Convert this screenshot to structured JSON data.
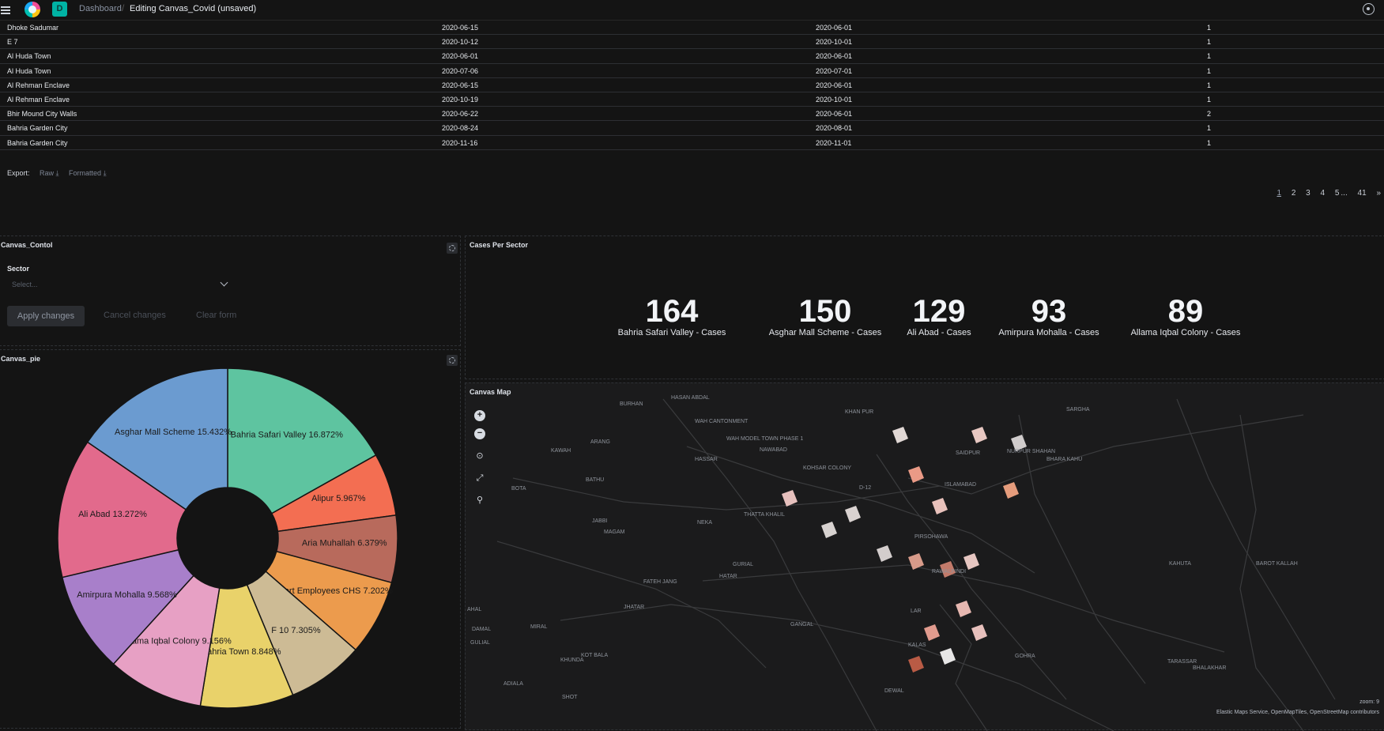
{
  "header": {
    "breadcrumb_dashboard": "Dashboard",
    "breadcrumb_current": "Editing Canvas_Covid (unsaved)",
    "space_initial": "D"
  },
  "table": {
    "rows": [
      [
        "Dhoke Sadumar",
        "2020-06-15",
        "2020-06-01",
        "1"
      ],
      [
        "E 7",
        "2020-10-12",
        "2020-10-01",
        "1"
      ],
      [
        "Al Huda Town",
        "2020-06-01",
        "2020-06-01",
        "1"
      ],
      [
        "Al Huda Town",
        "2020-07-06",
        "2020-07-01",
        "1"
      ],
      [
        "Al Rehman Enclave",
        "2020-06-15",
        "2020-06-01",
        "1"
      ],
      [
        "Al Rehman Enclave",
        "2020-10-19",
        "2020-10-01",
        "1"
      ],
      [
        "Bhir Mound City Walls",
        "2020-06-22",
        "2020-06-01",
        "2"
      ],
      [
        "Bahria Garden City",
        "2020-08-24",
        "2020-08-01",
        "1"
      ],
      [
        "Bahria Garden City",
        "2020-11-16",
        "2020-11-01",
        "1"
      ]
    ]
  },
  "export": {
    "label": "Export:",
    "raw": "Raw",
    "formatted": "Formatted"
  },
  "pagination": {
    "pages": [
      "1",
      "2",
      "3",
      "4",
      "5"
    ],
    "ellipsis": "...",
    "last": "41",
    "next": "»"
  },
  "control_panel": {
    "title": "Canvas_Contol",
    "sector_label": "Sector",
    "select_placeholder": "Select...",
    "apply": "Apply changes",
    "cancel": "Cancel changes",
    "clear": "Clear form"
  },
  "pie_panel": {
    "title": "Canvas_pie"
  },
  "metrics_panel": {
    "title": "Cases Per Sector",
    "items": [
      {
        "value": "164",
        "label": "Bahria Safari Valley - Cases"
      },
      {
        "value": "150",
        "label": "Asghar Mall Scheme - Cases"
      },
      {
        "value": "129",
        "label": "Ali Abad - Cases"
      },
      {
        "value": "93",
        "label": "Amirpura Mohalla - Cases"
      },
      {
        "value": "89",
        "label": "Allama Iqbal Colony - Cases"
      }
    ]
  },
  "map_panel": {
    "title": "Canvas Map",
    "zoom_label": "zoom: 9",
    "attribution": "Elastic Maps Service, OpenMapTiles, OpenStreetMap contributors",
    "place_labels": [
      "BURHAN",
      "HASAN ABDAL",
      "WAH CANTONMENT",
      "WAH MODEL TOWN PHASE 1",
      "KHAN PUR",
      "SARGHA",
      "NAWABAD",
      "KOHSAR COLONY",
      "SAIDPUR",
      "NURPUR SHAHAN",
      "BHARA KAHU",
      "KAWAH",
      "ARANG",
      "HASSAR",
      "D-12",
      "ISLAMABAD",
      "BATHU",
      "BOTA",
      "THATTA KHALIL",
      "JABBI",
      "MAGAM",
      "NEKA",
      "PIRSOHAWA",
      "BAROT KALLAH",
      "RAWALPINDI",
      "KAHUTA",
      "GURIAL",
      "HATAR",
      "FATEH JANG",
      "AHAL",
      "JHATAR",
      "GANGAL",
      "DAMAL",
      "MIRAL",
      "LAR",
      "KALAS",
      "GOHRA",
      "BHALAKHAR",
      "TARASSAR",
      "GULIAL",
      "KOT BALA",
      "KHUNDA",
      "ADIALA",
      "DEWAL",
      "SHOT"
    ]
  },
  "chart_data": {
    "type": "pie",
    "donut": true,
    "slices": [
      {
        "label": "Bahria Safari Valley",
        "percent": 16.872,
        "color": "#5ec4a0"
      },
      {
        "label": "Alipur",
        "percent": 5.967,
        "color": "#f36e52"
      },
      {
        "label": "Aria Muhallah",
        "percent": 6.379,
        "color": "#b86a5c"
      },
      {
        "label": "Airport Employees CHS",
        "percent": 7.202,
        "color": "#ec9b4d"
      },
      {
        "label": "F 10",
        "percent": 7.305,
        "color": "#cdbb95"
      },
      {
        "label": "Bahria Town",
        "percent": 8.848,
        "color": "#e9d26a"
      },
      {
        "label": "Allama Iqbal Colony",
        "percent": 9.156,
        "color": "#e7a0c4"
      },
      {
        "label": "Amirpura Mohalla",
        "percent": 9.568,
        "color": "#a87fca"
      },
      {
        "label": "Ali Abad",
        "percent": 13.272,
        "color": "#e26a8c"
      },
      {
        "label": "Asghar Mall Scheme",
        "percent": 15.432,
        "color": "#6b9bd0"
      }
    ]
  }
}
